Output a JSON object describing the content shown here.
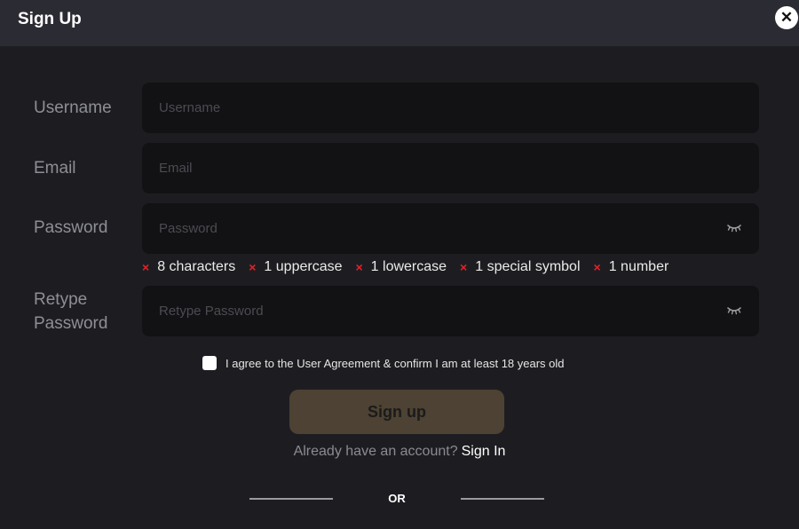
{
  "header": {
    "title": "Sign Up",
    "close_icon": "close-icon"
  },
  "form": {
    "username": {
      "label": "Username",
      "placeholder": "Username",
      "value": ""
    },
    "email": {
      "label": "Email",
      "placeholder": "Email",
      "value": ""
    },
    "password": {
      "label": "Password",
      "placeholder": "Password",
      "value": "",
      "toggle_icon": "eye-closed-icon"
    },
    "retype": {
      "label_line1": "Retype",
      "label_line2": "Password",
      "placeholder": "Retype Password",
      "value": "",
      "toggle_icon": "eye-closed-icon"
    },
    "password_rules": [
      {
        "label": "8 characters",
        "status": "unmet"
      },
      {
        "label": "1 uppercase",
        "status": "unmet"
      },
      {
        "label": "1 lowercase",
        "status": "unmet"
      },
      {
        "label": "1 special symbol",
        "status": "unmet"
      },
      {
        "label": "1 number",
        "status": "unmet"
      }
    ],
    "rule_unmet_icon": "×",
    "agreement": {
      "text": "I agree to the User Agreement & confirm I am at least 18 years old",
      "checked": false
    },
    "submit_label": "Sign up"
  },
  "footer": {
    "have_account_text": "Already have an account?",
    "signin_label": "Sign In",
    "or_text": "OR"
  },
  "colors": {
    "background": "#1d1d21",
    "header_bg": "#2b2b33",
    "input_bg": "#121214",
    "error_red": "#e0232a",
    "button_bg": "#4d4233"
  }
}
